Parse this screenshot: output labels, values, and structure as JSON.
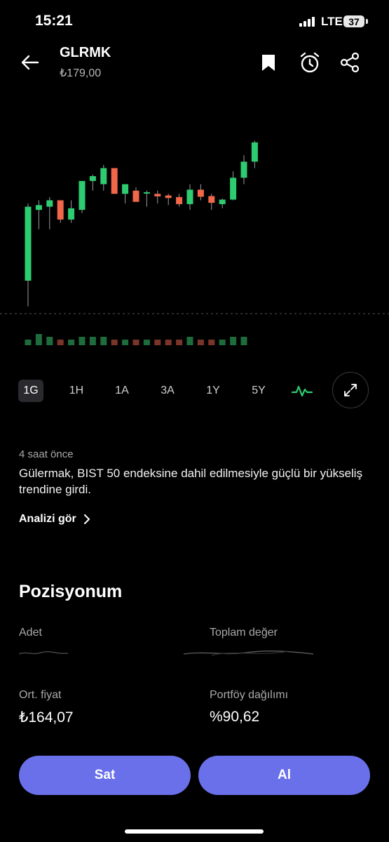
{
  "status": {
    "time": "15:21",
    "network": "LTE",
    "battery": "37"
  },
  "header": {
    "ticker": "GLRMK",
    "price": "₺179,00"
  },
  "chart_data": {
    "type": "candlestick",
    "candles": [
      {
        "o": 142,
        "h": 166,
        "l": 134,
        "c": 165
      },
      {
        "o": 164,
        "h": 167,
        "l": 158,
        "c": 165.5
      },
      {
        "o": 165,
        "h": 168,
        "l": 158,
        "c": 167
      },
      {
        "o": 167,
        "h": 165,
        "l": 160,
        "c": 161
      },
      {
        "o": 161,
        "h": 167,
        "l": 160,
        "c": 164.5
      },
      {
        "o": 164,
        "h": 172,
        "l": 163,
        "c": 173
      },
      {
        "o": 173,
        "h": 175,
        "l": 170,
        "c": 174.5
      },
      {
        "o": 172,
        "h": 178,
        "l": 170,
        "c": 177
      },
      {
        "o": 177,
        "h": 177,
        "l": 169,
        "c": 169
      },
      {
        "o": 169,
        "h": 172,
        "l": 166,
        "c": 172
      },
      {
        "o": 170,
        "h": 171,
        "l": 167,
        "c": 166.5
      },
      {
        "o": 169.5,
        "h": 170,
        "l": 165,
        "c": 169.5
      },
      {
        "o": 169,
        "h": 170,
        "l": 166,
        "c": 168.2
      },
      {
        "o": 168.5,
        "h": 169,
        "l": 165.5,
        "c": 167.7
      },
      {
        "o": 168,
        "h": 169,
        "l": 165,
        "c": 165.8
      },
      {
        "o": 165.8,
        "h": 172,
        "l": 164,
        "c": 170.3
      },
      {
        "o": 170.3,
        "h": 172,
        "l": 167,
        "c": 168.1
      },
      {
        "o": 168.3,
        "h": 169,
        "l": 164,
        "c": 166.2
      },
      {
        "o": 165.8,
        "h": 167.5,
        "l": 164.5,
        "c": 167.2
      },
      {
        "o": 167.2,
        "h": 176,
        "l": 167,
        "c": 174
      },
      {
        "o": 174,
        "h": 181,
        "l": 172,
        "c": 179
      },
      {
        "o": 179,
        "h": 185.5,
        "l": 177,
        "c": 185
      }
    ],
    "volume": [
      2,
      4,
      3,
      2,
      2,
      3,
      3,
      3,
      2,
      2,
      2,
      2,
      2,
      2,
      2,
      3,
      2,
      2,
      2,
      3,
      3,
      0
    ],
    "ylim": [
      130,
      190
    ],
    "grid": false
  },
  "ranges": [
    {
      "label": "1G",
      "active": true
    },
    {
      "label": "1H",
      "active": false
    },
    {
      "label": "1A",
      "active": false
    },
    {
      "label": "3A",
      "active": false
    },
    {
      "label": "1Y",
      "active": false
    },
    {
      "label": "5Y",
      "active": false
    }
  ],
  "news": {
    "time": "4 saat önce",
    "text": "Gülermak, BIST 50 endeksine dahil edilmesiyle güçlü bir yükseliş trendine girdi.",
    "link_label": "Analizi gör"
  },
  "position": {
    "title": "Pozisyonum",
    "qty_label": "Adet",
    "total_label": "Toplam değer",
    "avg_label": "Ort. fiyat",
    "avg_value": "₺164,07",
    "share_label": "Portföy dağılımı",
    "share_value": "%90,62"
  },
  "actions": {
    "sell_label": "Sat",
    "buy_label": "Al"
  },
  "colors": {
    "up": "#2ecc71",
    "down": "#f0674a",
    "accent": "#6a70ea"
  }
}
